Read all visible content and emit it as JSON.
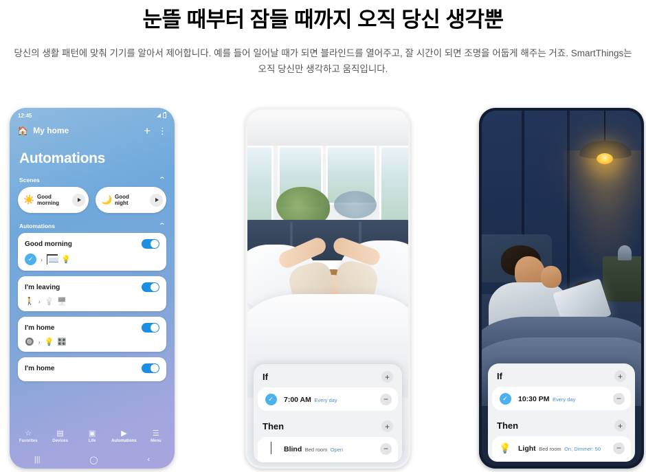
{
  "headline": "눈뜰 때부터 잠들 때까지 오직 당신 생각뿐",
  "subhead": "당신의 생활 패턴에 맞춰 기기를 알아서 제어합니다. 예를 들어 일어날 때가 되면 블라인드를 열어주고, 잘 시간이 되면 조명을 어둡게 해주는 거죠. SmartThings는 오직 당신만 생각하고 움직입니다.",
  "phone_left": {
    "status_bar": {
      "time": "12:45",
      "signal_icon": "signal-icon",
      "battery_icon": "battery-icon"
    },
    "app_bar": {
      "home_icon": "🏠",
      "title": "My home",
      "add_label": "+",
      "more_label": "⋮"
    },
    "page_title": "Automations",
    "scenes_section": {
      "label": "Scenes",
      "collapse_icon": "⌃",
      "items": [
        {
          "icon": "☀️",
          "name": "Good\nmorning",
          "name_line1": "Good",
          "name_line2": "morning",
          "play_icon": "play-icon"
        },
        {
          "icon": "🌙",
          "name": "Good\nnight",
          "name_line1": "Good",
          "name_line2": "night",
          "play_icon": "play-icon"
        }
      ]
    },
    "automations_section": {
      "label": "Automations",
      "collapse_icon": "⌃",
      "items": [
        {
          "name": "Good morning",
          "enabled": true,
          "trigger_icon": "🕐",
          "separator": "›",
          "action_icons": [
            "blind-icon",
            "💡"
          ]
        },
        {
          "name": "I'm leaving",
          "enabled": true,
          "trigger_icon": "🚶",
          "separator": "›",
          "action_icons": [
            "🔘",
            "📺"
          ]
        },
        {
          "name": "I'm home",
          "enabled": true,
          "trigger_icon": "🔈",
          "separator": "›",
          "action_icons": [
            "💡",
            "🎛️"
          ]
        },
        {
          "name": "I'm home",
          "enabled": true,
          "trigger_icon": "",
          "separator": "",
          "action_icons": []
        }
      ]
    },
    "tab_bar": [
      {
        "glyph": "☆",
        "label": "Favorites",
        "active": false
      },
      {
        "glyph": "▤",
        "label": "Devices",
        "active": false
      },
      {
        "glyph": "▣",
        "label": "Life",
        "active": false
      },
      {
        "glyph": "▶",
        "label": "Automations",
        "active": true
      },
      {
        "glyph": "☰",
        "label": "Menu",
        "active": false
      }
    ],
    "nav_bar": [
      {
        "glyph": "|||",
        "name": "recents-button"
      },
      {
        "glyph": "◯",
        "name": "home-button"
      },
      {
        "glyph": "‹",
        "name": "back-button"
      }
    ]
  },
  "phone_middle": {
    "photo_alt": "woman stretching awake in a white bed with morning light through windows",
    "card": {
      "if_label": "If",
      "if_add": "+",
      "if_row": {
        "icon": "clock-icon",
        "main": "7:00 AM",
        "sub": "Every day",
        "remove": "−"
      },
      "then_label": "Then",
      "then_add": "+",
      "then_row": {
        "icon": "blind-icon",
        "main": "Blind",
        "sub": "Bed room",
        "state": "Open",
        "remove": "−"
      }
    }
  },
  "phone_right": {
    "photo_alt": "man yawning in bed at night with a tablet under a warm pendant lamp",
    "card": {
      "if_label": "If",
      "if_add": "+",
      "if_row": {
        "icon": "clock-icon",
        "main": "10:30 PM",
        "sub": "Every day",
        "remove": "−"
      },
      "then_label": "Then",
      "then_add": "+",
      "then_row": {
        "icon": "bulb-icon",
        "main": "Light",
        "sub": "Bed room",
        "state": "On, Dimmer: 50",
        "remove": "−"
      }
    }
  },
  "colors": {
    "accent_blue": "#1a8fe3",
    "link_blue": "#4a90d9",
    "clock_blue": "#4db1f0",
    "night_frame": "#111c32",
    "card_bg": "#f1f2f4"
  }
}
